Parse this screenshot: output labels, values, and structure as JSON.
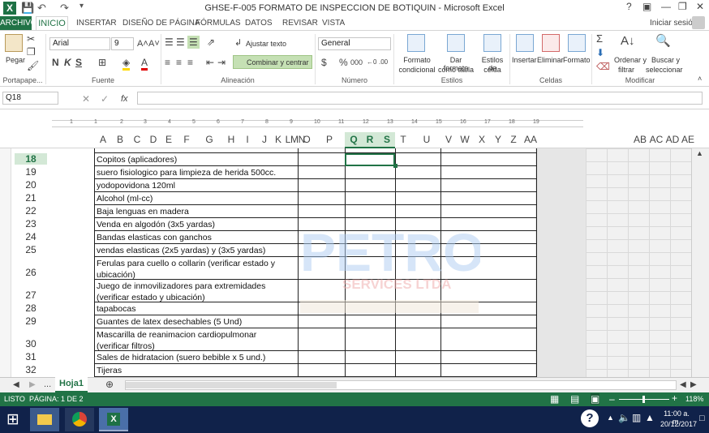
{
  "window": {
    "title": "GHSE-F-005 FORMATO DE INSPECCION DE BOTIQUIN - Microsoft Excel",
    "help": "?"
  },
  "tabs": {
    "archivo": "ARCHIVO",
    "inicio": "INICIO",
    "insertar": "INSERTAR",
    "diseno": "DISEÑO DE PÁGINA",
    "formulas": "FÓRMULAS",
    "datos": "DATOS",
    "revisar": "REVISAR",
    "vista": "VISTA",
    "signin": "Iniciar sesión"
  },
  "ribbon": {
    "clipboard": {
      "label": "Portapape...",
      "paste": "Pegar"
    },
    "font": {
      "label": "Fuente",
      "name": "Arial",
      "size": "9"
    },
    "alignment": {
      "label": "Alineación",
      "wrap": "Ajustar texto",
      "merge": "Combinar y centrar"
    },
    "number": {
      "label": "Número",
      "format": "General"
    },
    "styles": {
      "label": "Estilos",
      "cond1": "Formato",
      "cond2": "condicional",
      "table1": "Dar formato",
      "table2": "como tabla",
      "cell1": "Estilos de",
      "cell2": "celda"
    },
    "cells": {
      "label": "Celdas",
      "insert": "Insertar",
      "delete": "Eliminar",
      "format": "Formato"
    },
    "editing": {
      "label": "Modificar",
      "sort1": "Ordenar y",
      "sort2": "filtrar",
      "find1": "Buscar y",
      "find2": "seleccionar"
    }
  },
  "formula_bar": {
    "namebox": "Q18",
    "fx": "fx",
    "content": ""
  },
  "ruler_numbers": [
    "1",
    "1",
    "2",
    "3",
    "4",
    "5",
    "6",
    "7",
    "8",
    "9",
    "10",
    "11",
    "12",
    "13",
    "14",
    "15",
    "16",
    "17",
    "18",
    "19"
  ],
  "columns": [
    "A",
    "B",
    "C",
    "D",
    "E",
    "F",
    "G",
    "H",
    "I",
    "J",
    "K",
    "L",
    "M",
    "N",
    "O",
    "P",
    "Q",
    "R",
    "S",
    "T",
    "U",
    "V",
    "W",
    "X",
    "Y",
    "Z",
    "AA",
    "AB",
    "AC",
    "AD",
    "AE"
  ],
  "rows": [
    {
      "num": "18",
      "text": "Copitos (aplicadores)"
    },
    {
      "num": "19",
      "text": "suero fisiologico para limpieza de herida 500cc."
    },
    {
      "num": "20",
      "text": "yodopovidona 120ml"
    },
    {
      "num": "21",
      "text": "Alcohol (ml-cc)"
    },
    {
      "num": "22",
      "text": "Baja lenguas en madera"
    },
    {
      "num": "23",
      "text": "Venda en algodón (3x5 yardas)"
    },
    {
      "num": "24",
      "text": "Bandas elasticas con ganchos"
    },
    {
      "num": "25",
      "text": "vendas elasticas (2x5 yardas) y (3x5 yardas)"
    },
    {
      "num": "26",
      "text": "Ferulas para cuello o collarin (verificar estado y",
      "text2": "ubicación)"
    },
    {
      "num": "27",
      "text": "Juego de inmovilizadores para extremidades",
      "text2": "(verificar estado y ubicación)"
    },
    {
      "num": "28",
      "text": "tapabocas"
    },
    {
      "num": "29",
      "text": "Guantes de latex desechables (5 Und)"
    },
    {
      "num": "30",
      "text": "Mascarilla de reanimacion cardiopulmonar",
      "text2": "(verificar filtros)"
    },
    {
      "num": "31",
      "text": "Sales de hidratacion (suero bebible x 5 und.)"
    },
    {
      "num": "32",
      "text": "Tijeras"
    }
  ],
  "watermark": {
    "line1": "PETROL",
    "line2": "SERVICES LTDA"
  },
  "sheet_tab": "Hoja1",
  "sheet_nav_more": "...",
  "status": {
    "ready": "LISTO",
    "page": "PÁGINA: 1 DE 2",
    "zoom": "118%"
  },
  "taskbar": {
    "time": "11:00 a. m.",
    "date": "20/12/2017"
  },
  "colors": {
    "excel_green": "#217346",
    "taskbar": "#10224a"
  }
}
